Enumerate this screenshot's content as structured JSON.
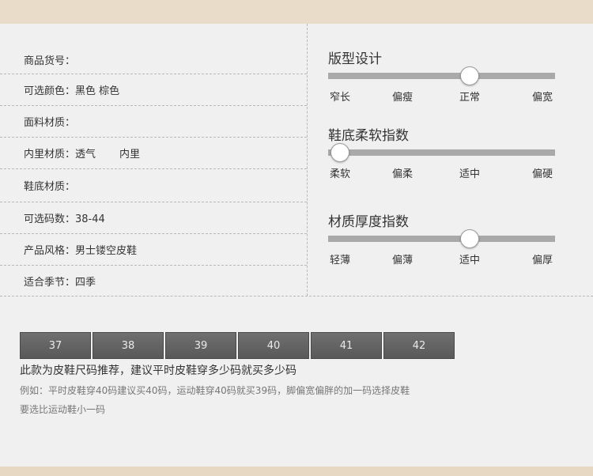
{
  "specs": [
    {
      "label": "商品货号：",
      "value": "",
      "extra": ""
    },
    {
      "label": "可选颜色：",
      "value": "黑色 棕色",
      "extra": ""
    },
    {
      "label": "面料材质：",
      "value": "",
      "extra": ""
    },
    {
      "label": "内里材质：",
      "value": "透气",
      "extra": "内里"
    },
    {
      "label": "鞋底材质：",
      "value": "",
      "extra": ""
    },
    {
      "label": "可选码数：",
      "value": "38-44",
      "extra": ""
    },
    {
      "label": "产品风格：",
      "value": "男士镂空皮鞋",
      "extra": ""
    },
    {
      "label": "适合季节：",
      "value": "四季",
      "extra": ""
    }
  ],
  "meters": [
    {
      "title": "版型设计",
      "labels": [
        "窄长",
        "偏瘦",
        "正常",
        "偏宽"
      ],
      "level": 0.62
    },
    {
      "title": "鞋底柔软指数",
      "labels": [
        "柔软",
        "偏柔",
        "适中",
        "偏硬"
      ],
      "level": 0.05
    },
    {
      "title": "材质厚度指数",
      "labels": [
        "轻薄",
        "偏薄",
        "适中",
        "偏厚"
      ],
      "level": 0.62
    }
  ],
  "sizes": [
    "37",
    "38",
    "39",
    "40",
    "41",
    "42"
  ],
  "note": {
    "title": "此款为皮鞋尺码推荐，建议平时皮鞋穿多少码就买多少码",
    "line1": "例如：平时皮鞋穿40码建议买40码，运动鞋穿40码就买39码，脚偏宽偏胖的加一码选择皮鞋",
    "line2": "要选比运动鞋小一码"
  },
  "colors": {
    "band": "#e9dcc8",
    "panel": "#f0f0f0",
    "bar": "#a9a9a9",
    "size_cell": "#626262"
  }
}
